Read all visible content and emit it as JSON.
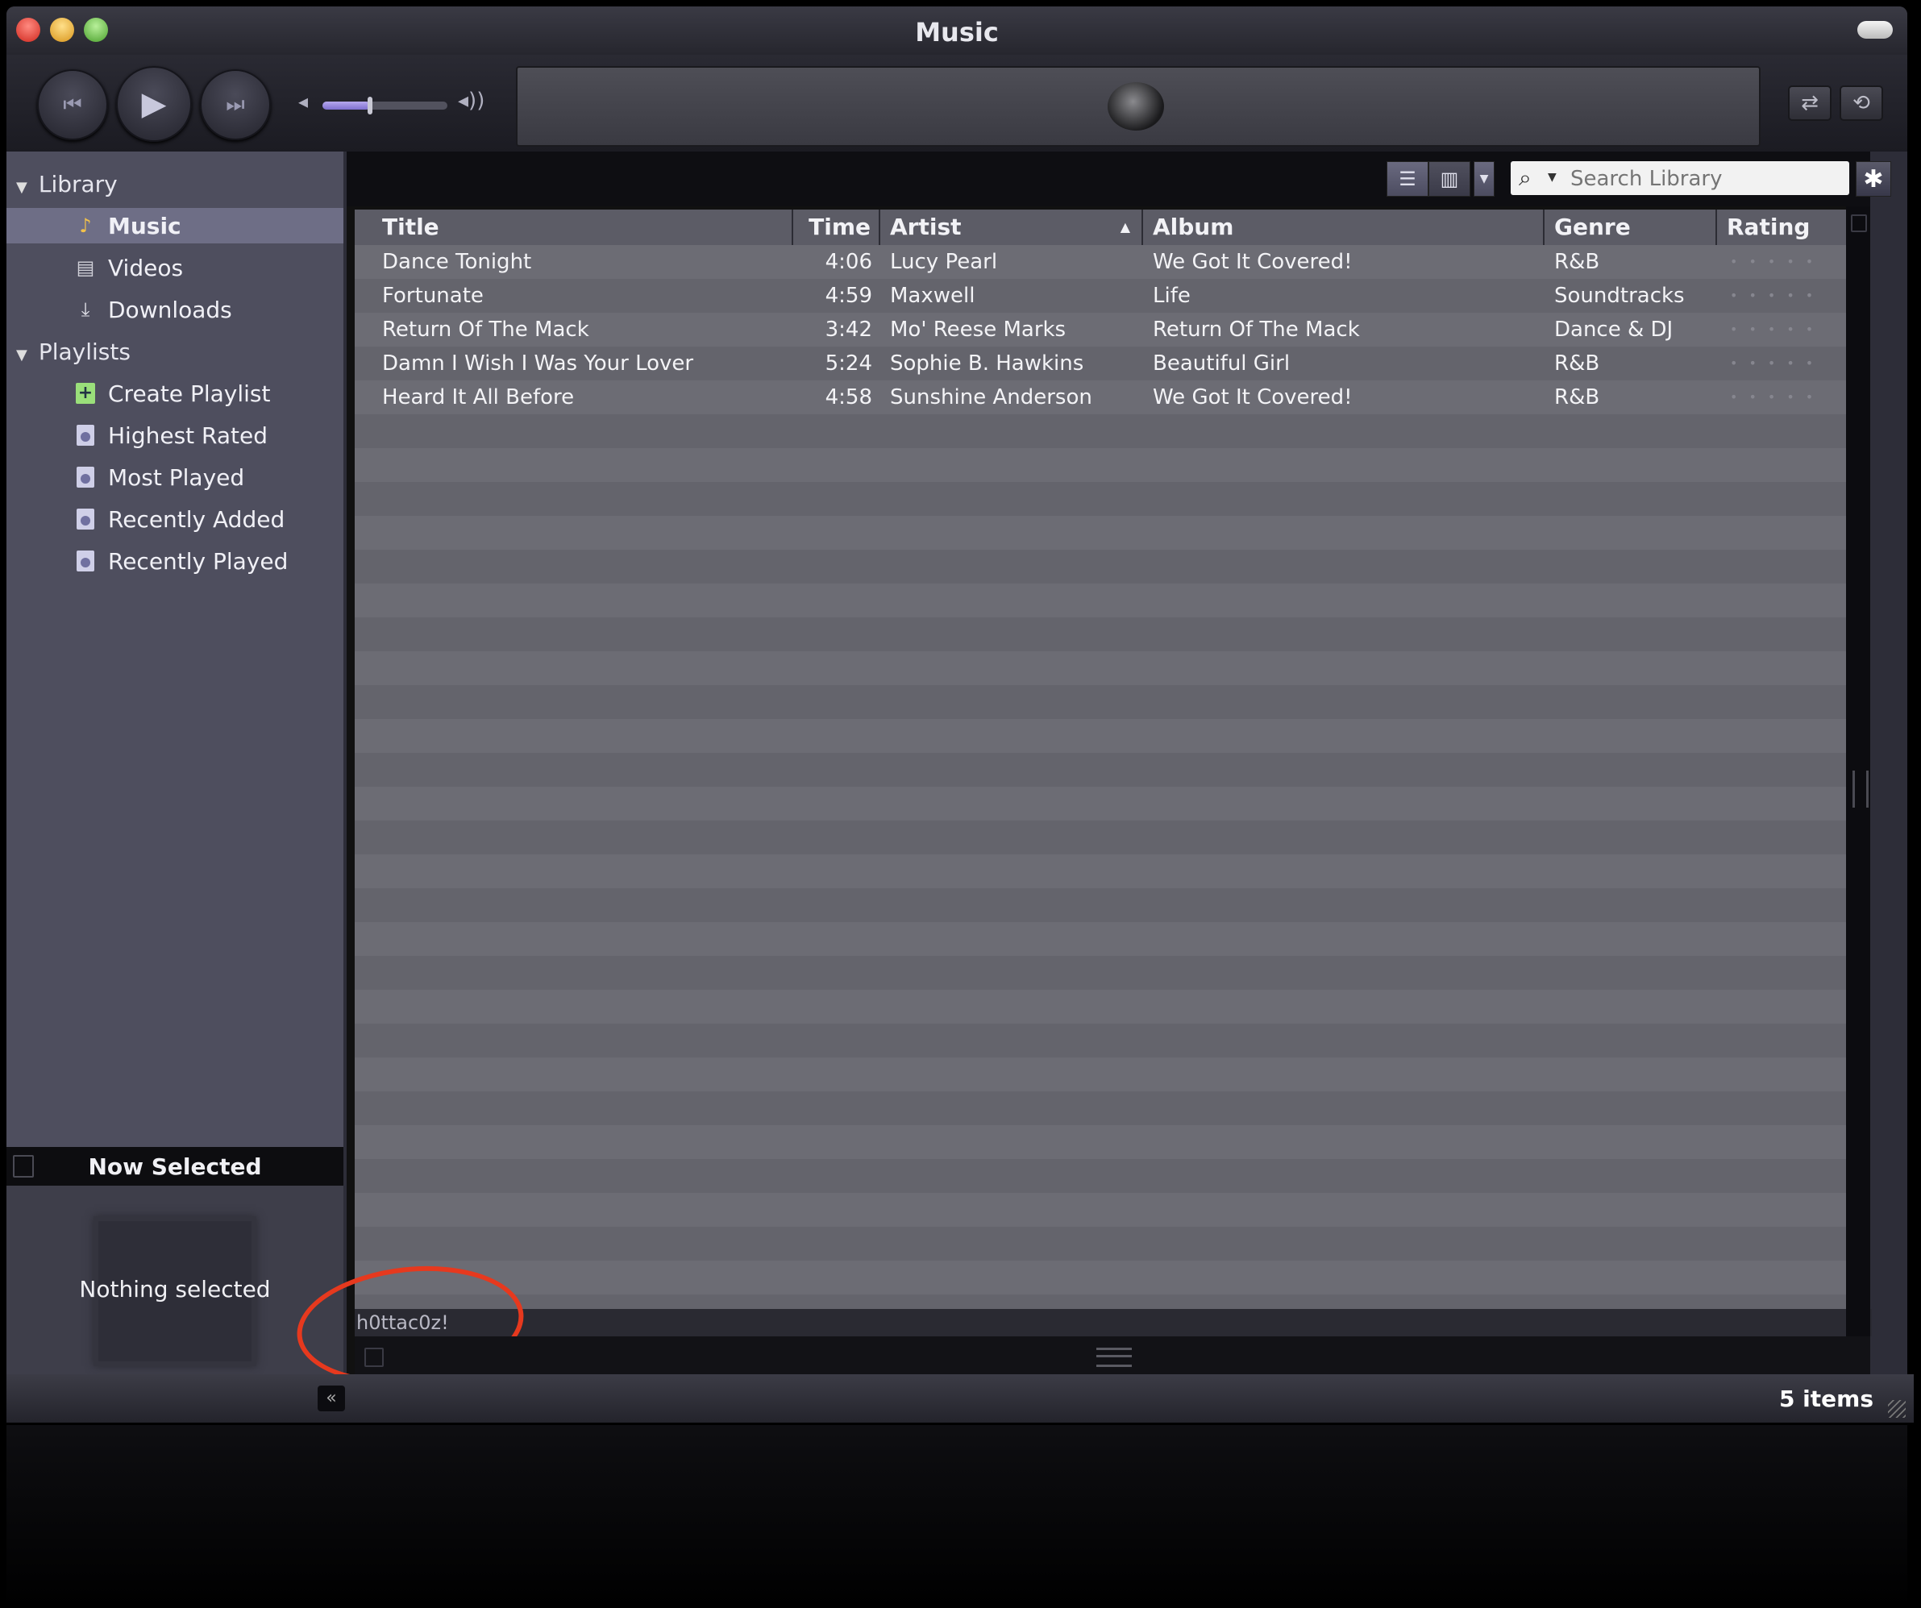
{
  "window": {
    "title": "Music"
  },
  "toolbar": {
    "prev_icon": "previous-track-icon",
    "play_icon": "play-icon",
    "next_icon": "next-track-icon",
    "volume_level": 0.38,
    "shuffle_icon": "shuffle-icon",
    "repeat_icon": "repeat-icon"
  },
  "sidebar": {
    "library_label": "Library",
    "library_items": [
      {
        "label": "Music",
        "icon": "music-note-icon",
        "selected": true
      },
      {
        "label": "Videos",
        "icon": "film-icon",
        "selected": false
      },
      {
        "label": "Downloads",
        "icon": "download-icon",
        "selected": false
      }
    ],
    "playlists_label": "Playlists",
    "playlist_items": [
      {
        "label": "Create Playlist",
        "icon": "add-playlist-icon"
      },
      {
        "label": "Highest Rated",
        "icon": "smart-playlist-icon"
      },
      {
        "label": "Most Played",
        "icon": "smart-playlist-icon"
      },
      {
        "label": "Recently Added",
        "icon": "smart-playlist-icon"
      },
      {
        "label": "Recently Played",
        "icon": "smart-playlist-icon"
      }
    ],
    "now_selected_title": "Now Selected",
    "now_selected_text": "Nothing selected"
  },
  "search": {
    "placeholder": "Search Library"
  },
  "table": {
    "columns": [
      "Title",
      "Time",
      "Artist",
      "Album",
      "Genre",
      "Rating"
    ],
    "sorted_column": "Artist",
    "rows": [
      {
        "title": "Dance Tonight",
        "time": "4:06",
        "artist": "Lucy Pearl",
        "album": "We Got It Covered!",
        "genre": "R&B",
        "rating": 0
      },
      {
        "title": "Fortunate",
        "time": "4:59",
        "artist": "Maxwell",
        "album": "Life",
        "genre": "Soundtracks",
        "rating": 0
      },
      {
        "title": "Return Of The Mack",
        "time": "3:42",
        "artist": "Mo' Reese Marks",
        "album": "Return Of The Mack",
        "genre": "Dance & DJ",
        "rating": 0
      },
      {
        "title": "Damn I Wish I Was Your Lover",
        "time": "5:24",
        "artist": "Sophie B. Hawkins",
        "album": "Beautiful Girl",
        "genre": "R&B",
        "rating": 0
      },
      {
        "title": "Heard It All Before",
        "time": "4:58",
        "artist": "Sunshine Anderson",
        "album": "We Got It Covered!",
        "genre": "R&B",
        "rating": 0
      }
    ]
  },
  "filter_text": "h0ttac0z!",
  "status": {
    "item_count": "5 items",
    "collapse_label": "«"
  },
  "colors": {
    "accent": "#8a7bdc",
    "annotation_circle": "#e6391e"
  }
}
